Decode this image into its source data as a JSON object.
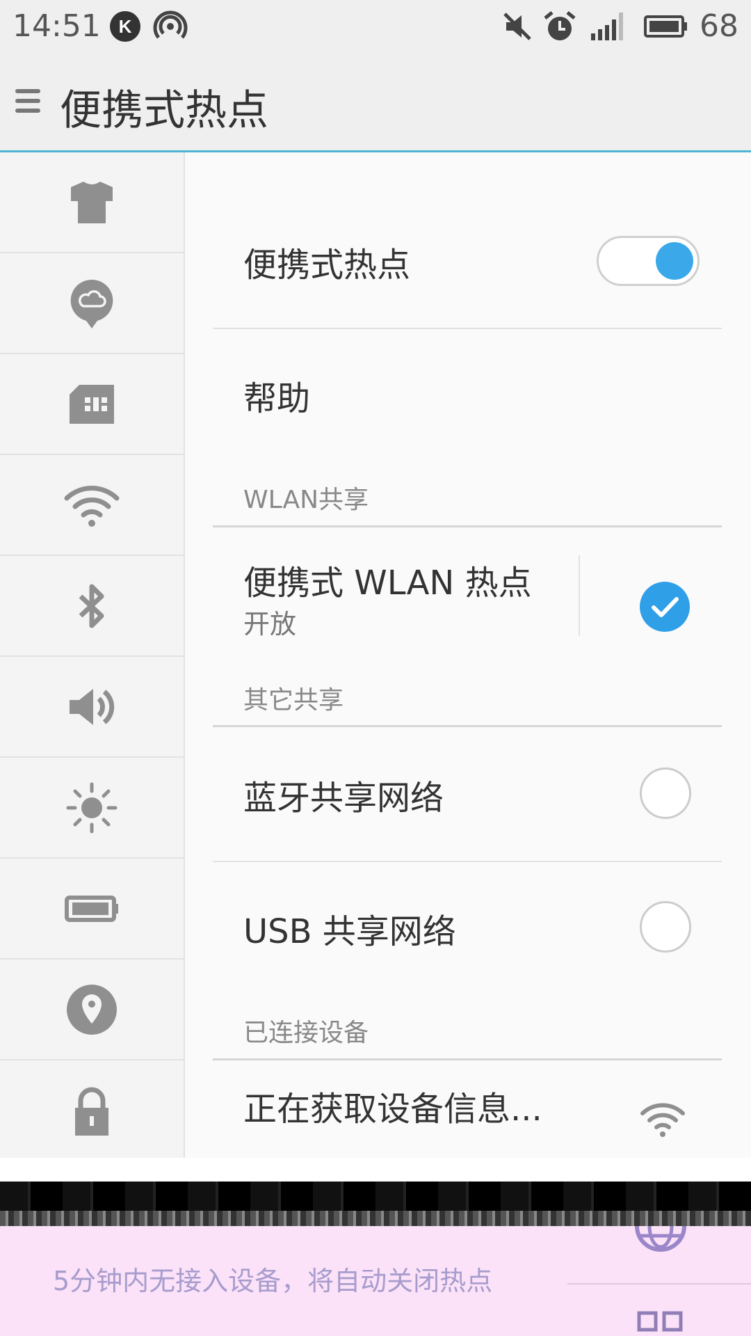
{
  "status_bar": {
    "time": "14:51",
    "battery_level": "68",
    "icons": [
      "k-app-icon",
      "hotspot-status-icon",
      "mute-icon",
      "alarm-icon",
      "signal-icon",
      "battery-icon"
    ]
  },
  "header": {
    "title": "便携式热点"
  },
  "sidebar": {
    "items": [
      {
        "icon": "theme-shirt-icon"
      },
      {
        "icon": "cloud-icon"
      },
      {
        "icon": "sim-card-icon"
      },
      {
        "icon": "wifi-icon"
      },
      {
        "icon": "bluetooth-icon"
      },
      {
        "icon": "sound-icon"
      },
      {
        "icon": "brightness-icon"
      },
      {
        "icon": "battery-icon"
      },
      {
        "icon": "location-icon"
      },
      {
        "icon": "lock-icon"
      }
    ]
  },
  "main": {
    "hotspot_label": "便携式热点",
    "hotspot_enabled": true,
    "help_label": "帮助",
    "wlan_section": "WLAN共享",
    "wlan_hotspot_label": "便携式 WLAN 热点",
    "wlan_hotspot_status": "开放",
    "wlan_hotspot_checked": true,
    "other_section": "其它共享",
    "bt_tether_label": "蓝牙共享网络",
    "usb_tether_label": "USB 共享网络",
    "connected_section": "已连接设备",
    "device_label": "正在获取设备信息..."
  },
  "toast": {
    "message": "5分钟内无接入设备，将自动关闭热点"
  },
  "colors": {
    "accent": "#3ba8ea",
    "title_bar": "#efefef",
    "divider_accent": "#4eb3d3",
    "toast_bg": "#fbe2f8"
  }
}
